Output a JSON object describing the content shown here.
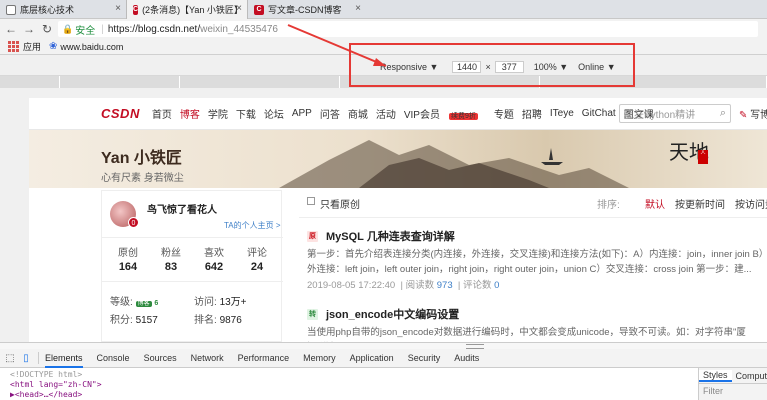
{
  "browser": {
    "tabs": [
      {
        "label": "底层核心技术",
        "active": false
      },
      {
        "label": "(2条消息)【Yan 小铁匠】",
        "active": true
      },
      {
        "label": "写文章-CSDN博客",
        "active": false
      }
    ],
    "secure_label": "安全",
    "url_host": "https://blog.csdn.net/",
    "url_path": "weixin_44535476",
    "bookmarks": [
      {
        "label": "应用",
        "icon": "apps-icon"
      },
      {
        "label": "www.baidu.com",
        "icon": "paw-icon"
      }
    ]
  },
  "device_toolbar": {
    "device": "Responsive",
    "width": "1440",
    "times": "×",
    "height": "377",
    "zoom": "100%",
    "throttle": "Online"
  },
  "csdn": {
    "logo": "CSDN",
    "nav": [
      "首页",
      "博客",
      "学院",
      "下载",
      "论坛",
      "APP",
      "问答",
      "商城",
      "活动",
      "VIP会员",
      "专题",
      "招聘",
      "ITeye",
      "GitChat",
      "图文课"
    ],
    "nav_current": "博客",
    "hot_badge": "续费9折",
    "search_placeholder": "疯狂Python精讲",
    "write_label": "写博"
  },
  "blog": {
    "name": "Yan 小铁匠",
    "subtitle": "心有尺素 身若微尘"
  },
  "profile": {
    "avatar_badge": "0",
    "username": "鸟飞惊了看花人",
    "homepage_link": "TA的个人主页 >",
    "stats": [
      {
        "label": "原创",
        "value": "164"
      },
      {
        "label": "粉丝",
        "value": "83"
      },
      {
        "label": "喜欢",
        "value": "642"
      },
      {
        "label": "评论",
        "value": "24"
      }
    ],
    "level_label": "等级:",
    "level_badge": "博客",
    "level_num": "6",
    "visits_label": "访问:",
    "visits_value": "13万+",
    "points_label": "积分:",
    "points_value": "5157",
    "rank_label": "排名:",
    "rank_value": "9876"
  },
  "list": {
    "only_original": "只看原创",
    "sort_label": "排序:",
    "sort_default": "默认",
    "sort_time": "按更新时间",
    "sort_visits": "按访问量"
  },
  "articles": [
    {
      "badge": "原",
      "title": "MySQL 几种连表查询详解",
      "desc": "第一步：首先介绍表连接分类(内连接，外连接，交叉连接)和连接方法(如下)：A）内连接：join，inner join B）外连接：left join，left outer join，right join，right outer join，union C）交叉连接：cross join 第一步：建...",
      "date": "2019-08-05 17:22:40",
      "reads_label": "阅读数",
      "reads": "973",
      "comments_label": "评论数",
      "comments": "0"
    },
    {
      "badge": "转",
      "title": "json_encode中文编码设置",
      "desc": "当使用php自带的json_encode对数据进行编码时，中文都会变成unicode，导致不可读。如：对字符串\"厦门\"进行json_encode...",
      "date": "",
      "reads_label": "",
      "reads": "",
      "comments_label": "",
      "comments": ""
    }
  ],
  "devtools": {
    "tabs": [
      "Elements",
      "Console",
      "Sources",
      "Network",
      "Performance",
      "Memory",
      "Application",
      "Security",
      "Audits"
    ],
    "active_tab": "Elements",
    "source_lines": [
      "<!DOCTYPE html>",
      "<html lang=\"zh-CN\">",
      "▶<head>…</head>"
    ],
    "styles_tabs": [
      "Styles",
      "Computed"
    ],
    "filter_placeholder": "Filter"
  },
  "colors": {
    "csdn_red": "#c30d23",
    "annotation_red": "#e53935",
    "devtools_blue": "#1a73e8",
    "secure_green": "#1e8e3e"
  }
}
